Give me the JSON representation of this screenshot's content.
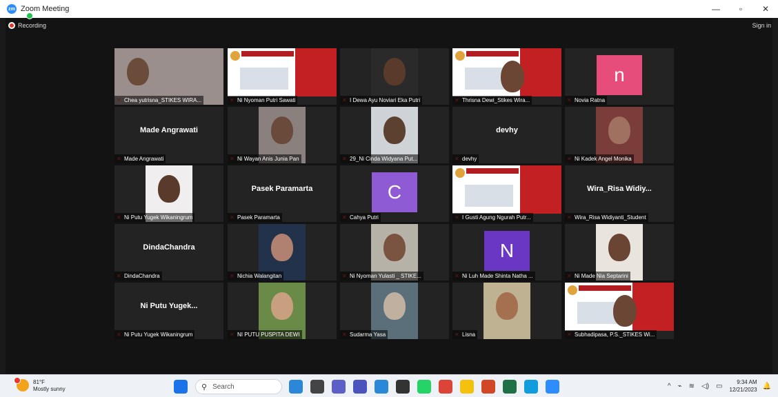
{
  "window": {
    "title": "Zoom Meeting",
    "recording_label": "Recording",
    "signin_label": "Sign in",
    "minimize": "—",
    "restore": "▫",
    "close": "✕"
  },
  "participants": [
    {
      "name": "Chea yutrisna_STIKES WIRA...",
      "tile": "video",
      "bg": "#9a8f8d",
      "skin": "#6b4b3a"
    },
    {
      "name": "Ni Nyoman Putri Sawati",
      "tile": "banner"
    },
    {
      "name": "I Dewa Ayu Noviari Eka Putri",
      "tile": "video",
      "bg": "#2a2a2a",
      "skin": "#5a3b2b"
    },
    {
      "name": "Thrisna Dewi_Stikes Wira...",
      "tile": "banner_person"
    },
    {
      "name": "Novia Ratna",
      "tile": "avatar",
      "letter": "n",
      "color": "#e64d7a"
    },
    {
      "name": "Made Angrawati",
      "tile": "name",
      "display": "Made Angrawati"
    },
    {
      "name": "Ni Wayan Anis Junia Pan",
      "tile": "video",
      "bg": "#8a817f",
      "skin": "#6a4a3a"
    },
    {
      "name": "29_Ni Cinda Widyana Put...",
      "tile": "video",
      "bg": "#cfd3d8",
      "skin": "#5c4030"
    },
    {
      "name": "devhy",
      "tile": "name",
      "display": "devhy"
    },
    {
      "name": "Ni Kadek Angel Monika",
      "tile": "video",
      "bg": "#7a3d3a",
      "skin": "#a07060"
    },
    {
      "name": "Ni Putu Yugek Wikaningrum",
      "tile": "video",
      "bg": "#f0eeee",
      "skin": "#5a3b2b"
    },
    {
      "name": "Pasek Paramarta",
      "tile": "name",
      "display": "Pasek Paramarta"
    },
    {
      "name": "Cahya Putri",
      "tile": "avatar",
      "letter": "C",
      "color": "#8e5bd5"
    },
    {
      "name": "I Gusti Agung Ngurah Putr...",
      "tile": "banner"
    },
    {
      "name": "Wira_Risa Widiyanti_Student",
      "tile": "name",
      "display": "Wira_Risa  Widiy..."
    },
    {
      "name": "DindaChandra",
      "tile": "name",
      "display": "DindaChandra"
    },
    {
      "name": "Nichia Walangitan",
      "tile": "video",
      "bg": "#22324a",
      "skin": "#b08070"
    },
    {
      "name": "Ni Nyoman Yulasti _ STIKE...",
      "tile": "video",
      "bg": "#b7b2a8",
      "skin": "#7a5440"
    },
    {
      "name": "Ni Luh Made Shinta Natha ...",
      "tile": "avatar",
      "letter": "N",
      "color": "#6a37c4"
    },
    {
      "name": "Ni Made Nia Septarini",
      "tile": "video",
      "bg": "#e9e4de",
      "skin": "#6a4534"
    },
    {
      "name": "Ni Putu Yugek Wikaningrum",
      "tile": "name",
      "display": "Ni  Putu  Yugek..."
    },
    {
      "name": "NI PUTU PUSPITA DEWI",
      "tile": "video",
      "bg": "#6a8a48",
      "skin": "#c8a080"
    },
    {
      "name": "Sudarma Yasa",
      "tile": "video",
      "bg": "#5a6f7a",
      "skin": "#c0b0a0"
    },
    {
      "name": "Lisna",
      "tile": "video",
      "bg": "#bfb293",
      "skin": "#a57050"
    },
    {
      "name": "Subhadipasa, P.S._STIKES Wi...",
      "tile": "banner_person"
    }
  ],
  "taskbar": {
    "weather_temp": "81°F",
    "weather_desc": "Mostly sunny",
    "search_placeholder": "Search",
    "time": "9:34 AM",
    "date": "12/21/2023",
    "icons": [
      {
        "name": "start",
        "color": "#1a73e8"
      },
      {
        "name": "widgets",
        "color": "#2b88d8"
      },
      {
        "name": "taskview",
        "color": "#444"
      },
      {
        "name": "meet",
        "color": "#5b5fc7"
      },
      {
        "name": "teams",
        "color": "#4b53bc"
      },
      {
        "name": "explorer",
        "color": "#2b88d8"
      },
      {
        "name": "store",
        "color": "#333"
      },
      {
        "name": "whatsapp",
        "color": "#25d366"
      },
      {
        "name": "chrome",
        "color": "#db4437"
      },
      {
        "name": "files",
        "color": "#f4c20d"
      },
      {
        "name": "powerpoint",
        "color": "#d24726"
      },
      {
        "name": "excel",
        "color": "#1e7145"
      },
      {
        "name": "edge",
        "color": "#0f9ddd"
      },
      {
        "name": "zoom",
        "color": "#2d8cff"
      }
    ]
  }
}
